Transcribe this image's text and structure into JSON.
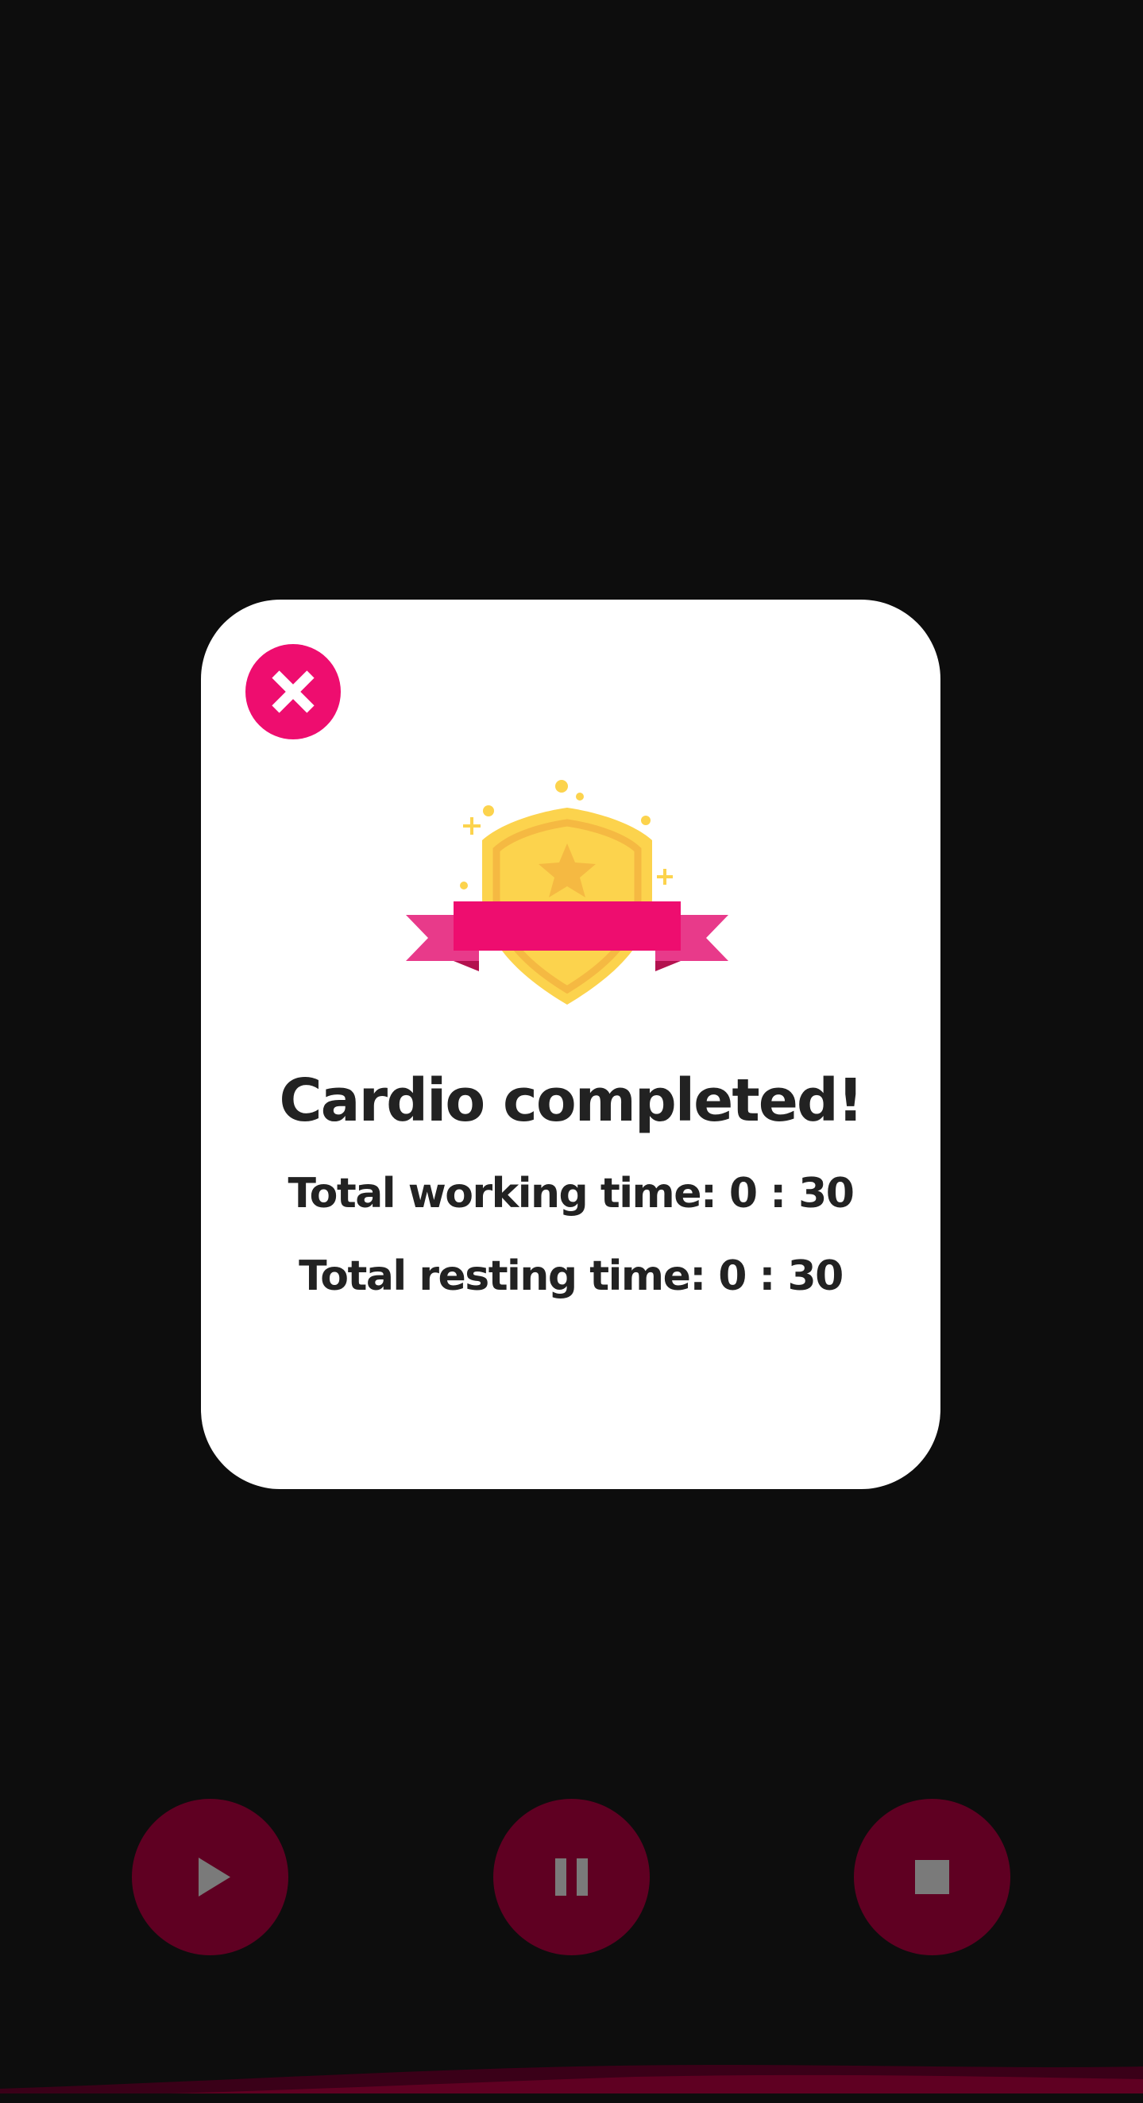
{
  "dialog": {
    "title": "Cardio completed!",
    "total_working_time": "Total working time: 0 : 30",
    "total_resting_time": "Total resting time: 0 : 30"
  },
  "icons": {
    "close": "close-icon",
    "badge": "trophy-shield-badge-icon",
    "play": "play-icon",
    "pause": "pause-icon",
    "stop": "stop-icon"
  },
  "colors": {
    "background": "#0d0d0d",
    "dialog": "#ffffff",
    "accent": "#ee0d6f",
    "control_dimmed": "#5f0022",
    "control_icon": "#7a7a7a",
    "shield": "#fcd34d",
    "shield_inner": "#f5b942",
    "text": "#222222"
  }
}
